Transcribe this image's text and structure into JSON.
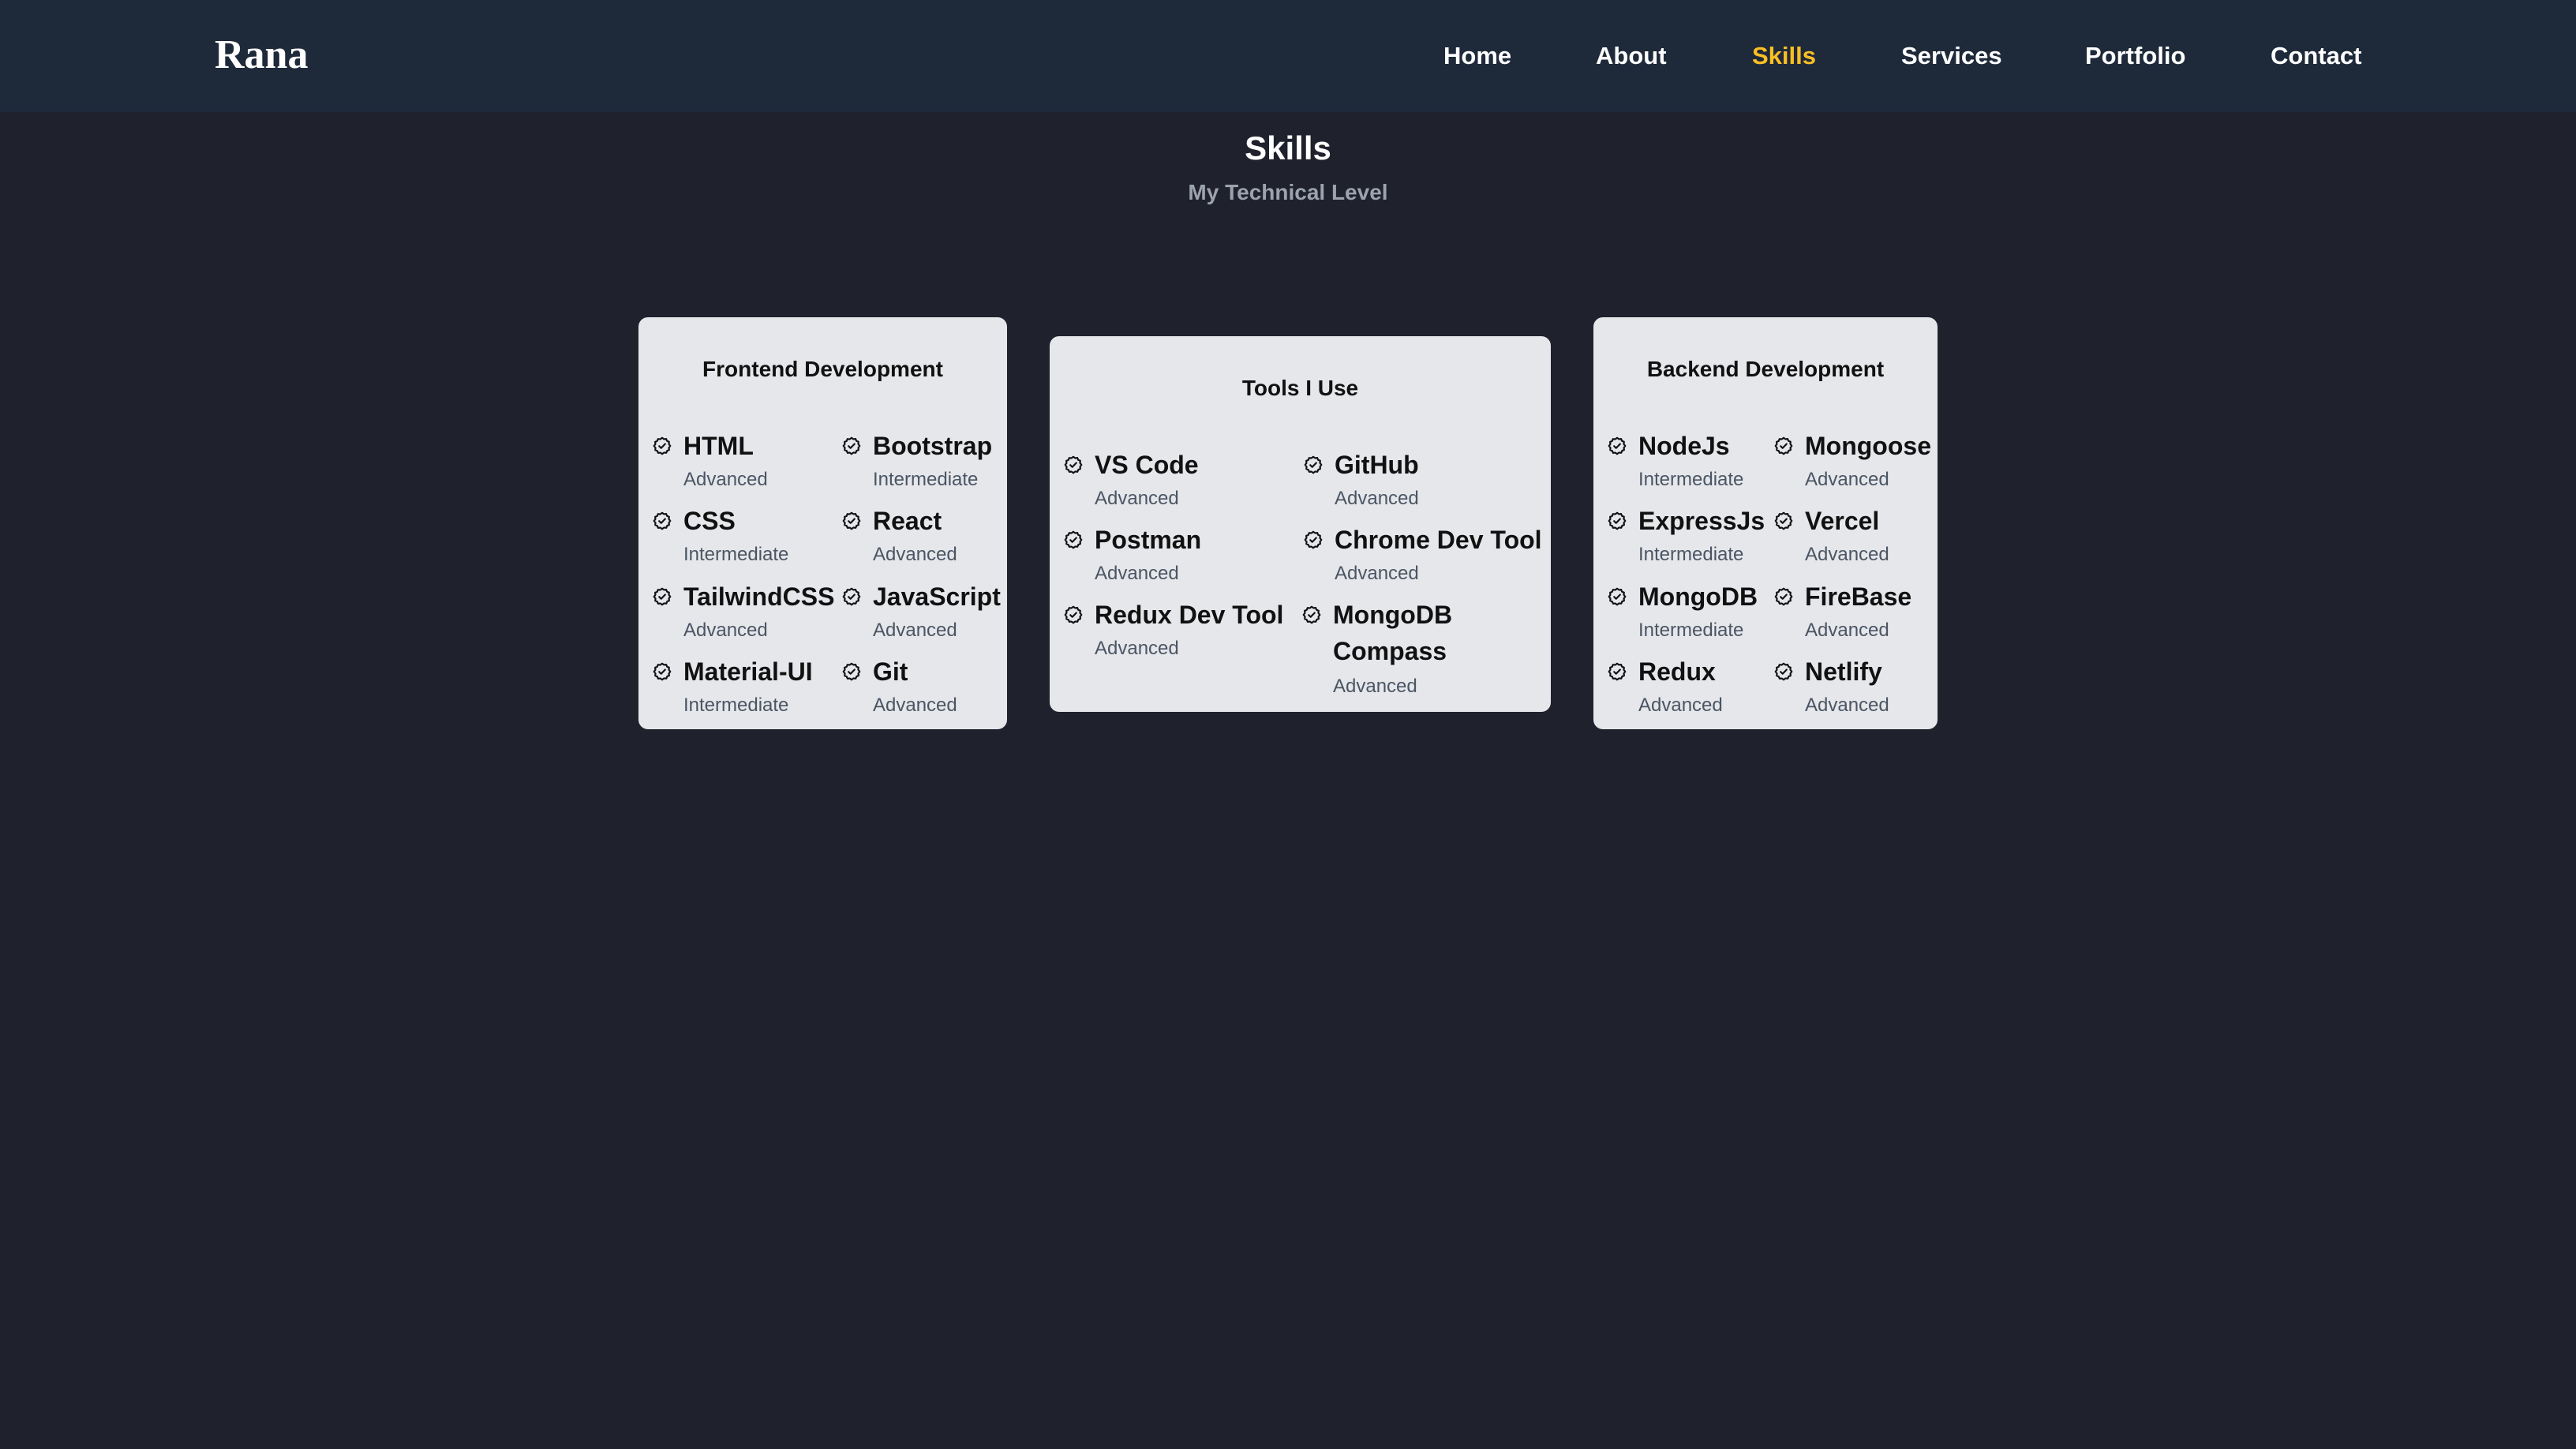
{
  "nav": {
    "logo": "Rana",
    "links": [
      "Home",
      "About",
      "Skills",
      "Services",
      "Portfolio",
      "Contact"
    ],
    "active": "Skills",
    "active_color": "#fbbf24"
  },
  "section": {
    "title": "Skills",
    "subtitle": "My Technical Level"
  },
  "cards": [
    {
      "title": "Frontend Development",
      "skills": [
        {
          "name": "HTML",
          "level": "Advanced"
        },
        {
          "name": "Bootstrap",
          "level": "Intermediate"
        },
        {
          "name": "CSS",
          "level": "Intermediate"
        },
        {
          "name": "React",
          "level": "Advanced"
        },
        {
          "name": "TailwindCSS",
          "level": "Advanced"
        },
        {
          "name": "JavaScript",
          "level": "Advanced"
        },
        {
          "name": "Material-UI",
          "level": "Intermediate"
        },
        {
          "name": "Git",
          "level": "Advanced"
        }
      ]
    },
    {
      "title": "Tools I Use",
      "skills": [
        {
          "name": "VS Code",
          "level": "Advanced"
        },
        {
          "name": "GitHub",
          "level": "Advanced"
        },
        {
          "name": "Postman",
          "level": "Advanced"
        },
        {
          "name": "Chrome Dev Tool",
          "level": "Advanced"
        },
        {
          "name": "Redux Dev Tool",
          "level": "Advanced"
        },
        {
          "name": "MongoDB Compass",
          "level": "Advanced"
        }
      ]
    },
    {
      "title": "Backend Development",
      "skills": [
        {
          "name": "NodeJs",
          "level": "Intermediate"
        },
        {
          "name": "Mongoose",
          "level": "Advanced"
        },
        {
          "name": "ExpressJs",
          "level": "Intermediate"
        },
        {
          "name": "Vercel",
          "level": "Advanced"
        },
        {
          "name": "MongoDB",
          "level": "Intermediate"
        },
        {
          "name": "FireBase",
          "level": "Advanced"
        },
        {
          "name": "Redux",
          "level": "Advanced"
        },
        {
          "name": "Netlify",
          "level": "Advanced"
        }
      ]
    }
  ],
  "icons": {
    "skill": "check-badge-icon"
  },
  "colors": {
    "background": "#1f212d",
    "navbar": "#1e293a",
    "card": "#e5e7eb"
  }
}
